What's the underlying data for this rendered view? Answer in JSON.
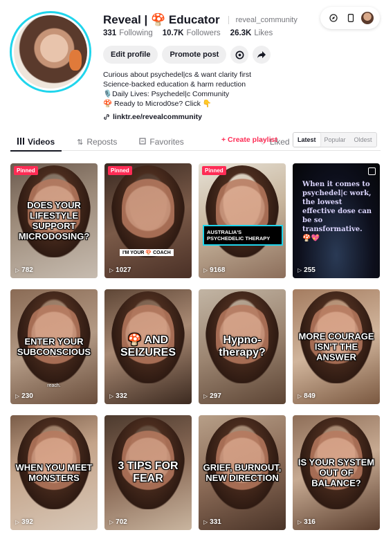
{
  "profile": {
    "display_name": "Reveal | 🍄 Educator",
    "username": "reveal_community",
    "following_count": "331",
    "following_label": "Following",
    "followers_count": "10.7K",
    "followers_label": "Followers",
    "likes_count": "26.3K",
    "likes_label": "Likes",
    "edit_profile_label": "Edit profile",
    "promote_post_label": "Promote post",
    "bio": [
      "Curious about psychedel|cs & want clarity first",
      "Science-backed education & harm reduction",
      "🎙️Daily Lives: Psychedel|c Community",
      "🍄 Ready to Microd0se? Click 👇"
    ],
    "link": "linktr.ee/revealcommunity"
  },
  "tabs": [
    {
      "label": "Videos",
      "icon": "grid-icon",
      "active": true
    },
    {
      "label": "Reposts",
      "icon": "repost-icon",
      "active": false
    },
    {
      "label": "Favorites",
      "icon": "bookmark-icon",
      "active": false
    },
    {
      "label": "Liked",
      "icon": "heart-icon",
      "active": false
    }
  ],
  "create_playlist_label": "+ Create playlist",
  "sort_options": [
    "Latest",
    "Popular",
    "Oldest"
  ],
  "sort_selected": "Latest",
  "colors": {
    "accent": "#fe2c55",
    "avatar_ring": "#20d5ec",
    "text": "#161823",
    "muted": "#75767c"
  },
  "videos": [
    {
      "caption": "DOES YOUR LIFESTYLE SUPPORT MICRODOSING?",
      "views": "782",
      "pinned_label": "Pinned"
    },
    {
      "caption": "",
      "overlay": "I'M YOUR 🍄 COACH",
      "views": "1027",
      "pinned_label": "Pinned"
    },
    {
      "caption": "",
      "banner": "AUSTRALIA'S PSYCHEDELIC THERAPY",
      "views": "9168",
      "pinned_label": "Pinned"
    },
    {
      "caption": "When it comes to psychedel|c work, the lowest effective dose can be so transformative. 🍄💖",
      "views": "255"
    },
    {
      "caption": "ENTER YOUR SUBCONSCIOUS",
      "sub": "reach.",
      "views": "230"
    },
    {
      "caption": "🍄 AND SEIZURES",
      "views": "332"
    },
    {
      "caption": "Hypno-therapy?",
      "views": "297"
    },
    {
      "caption": "MORE COURAGE ISN'T THE ANSWER",
      "views": "849"
    },
    {
      "caption": "WHEN YOU MEET MONSTERS",
      "views": "392"
    },
    {
      "caption": "3 TIPS FOR FEAR",
      "views": "702"
    },
    {
      "caption": "GRIEF, BURNOUT, NEW DIRECTION",
      "views": "331"
    },
    {
      "caption": "IS YOUR SYSTEM OUT OF BALANCE?",
      "views": "316"
    }
  ]
}
